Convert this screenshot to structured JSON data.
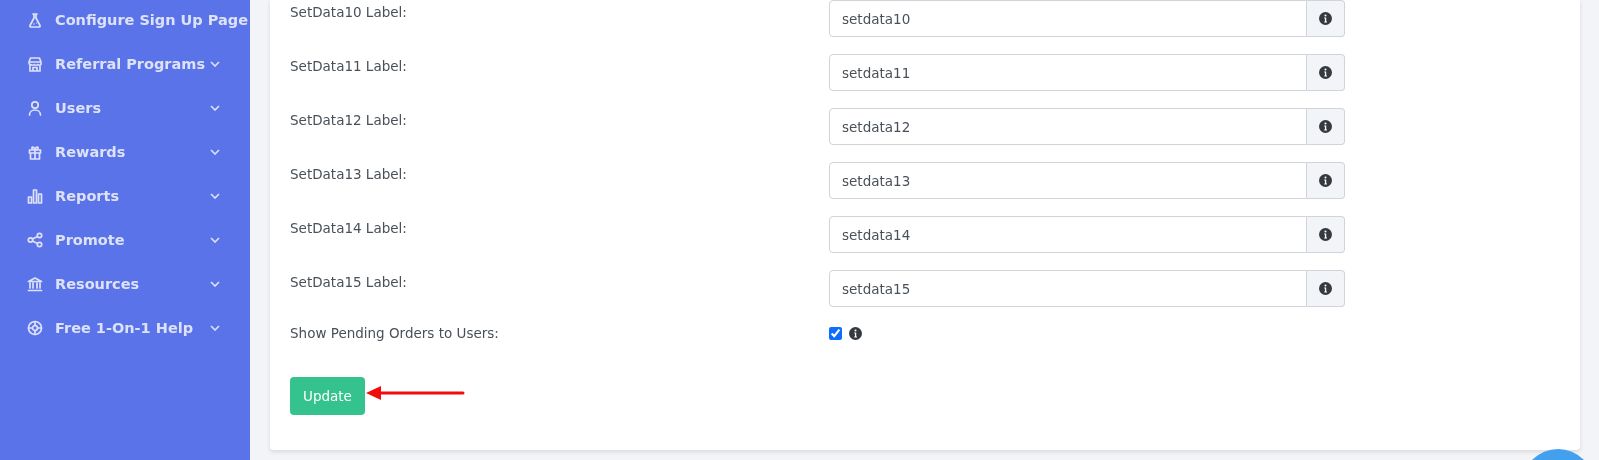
{
  "sidebar": {
    "items": [
      {
        "label": "Configure Sign Up Page",
        "kind": "link"
      },
      {
        "label": "Referral Programs",
        "kind": "dropdown"
      },
      {
        "label": "Users",
        "kind": "dropdown"
      },
      {
        "label": "Rewards",
        "kind": "dropdown"
      },
      {
        "label": "Reports",
        "kind": "dropdown"
      },
      {
        "label": "Promote",
        "kind": "dropdown"
      },
      {
        "label": "Resources",
        "kind": "dropdown"
      },
      {
        "label": "Free 1-On-1 Help",
        "kind": "dropdown"
      }
    ]
  },
  "form": {
    "fields": [
      {
        "label": "SetData10 Label:",
        "value": "setdata10"
      },
      {
        "label": "SetData11 Label:",
        "value": "setdata11"
      },
      {
        "label": "SetData12 Label:",
        "value": "setdata12"
      },
      {
        "label": "SetData13 Label:",
        "value": "setdata13"
      },
      {
        "label": "SetData14 Label:",
        "value": "setdata14"
      },
      {
        "label": "SetData15 Label:",
        "value": "setdata15"
      }
    ],
    "checkbox": {
      "label": "Show Pending Orders to Users:",
      "checked": true
    },
    "submit": "Update"
  }
}
